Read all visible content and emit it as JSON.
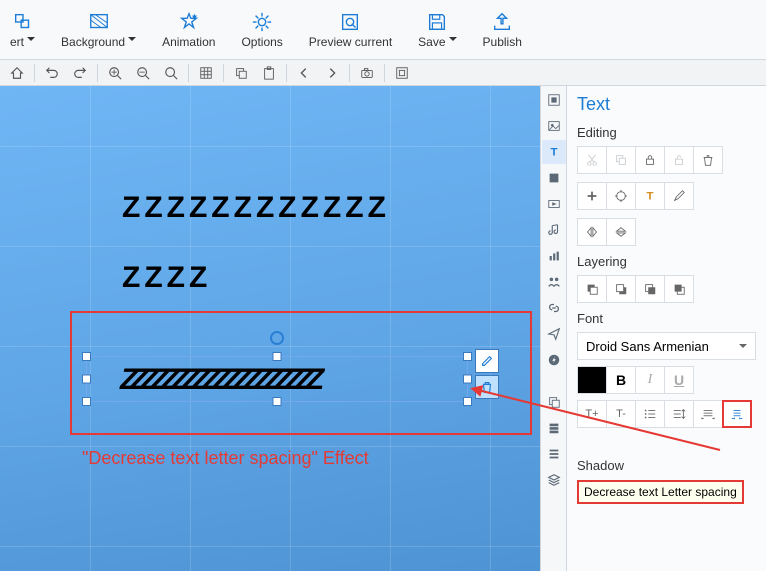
{
  "ribbon": {
    "insert": "ert",
    "background": "Background",
    "animation": "Animation",
    "options": "Options",
    "preview": "Preview current",
    "save": "Save",
    "publish": "Publish"
  },
  "panel": {
    "title": "Text",
    "editing": "Editing",
    "layering": "Layering",
    "font": "Font",
    "font_name": "Droid Sans Armenian",
    "bold": "B",
    "italic": "I",
    "underline": "U",
    "tplus": "T+",
    "tminus": "T-",
    "shadow_section": "Shadow",
    "shadow_label": "Shadow"
  },
  "tooltip": "Decrease text Letter spacing",
  "canvas": {
    "line1": "ZZZZZZZZZZZZ",
    "line2": "ZZZZ",
    "condensed": "ZZZZZZZZZZZZZZZZZZZ",
    "caption": "\"Decrease text letter spacing\" Effect"
  }
}
